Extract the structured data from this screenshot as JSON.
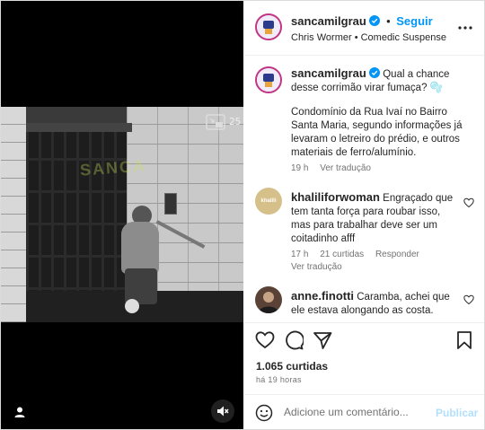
{
  "colors": {
    "accent": "#0095f6",
    "text": "#262626",
    "muted": "#737373",
    "border": "#dbdbdb",
    "media_bg": "#000000"
  },
  "media": {
    "watermark": "SANCA",
    "camera_timestamp": "25",
    "icons": [
      "picture-in-picture-icon",
      "user-tag-icon",
      "mute-icon"
    ]
  },
  "header": {
    "username": "sancamilgrau",
    "separator": "•",
    "follow_label": "Seguir",
    "subtitle": "Chris Wormer • Comedic Suspense"
  },
  "caption": {
    "username": "sancamilgrau",
    "text_line1": "Qual a chance desse corrimão virar fumaça? 🫧",
    "text_body": "Condomínio da Rua Ivaí no Bairro Santa Maria, segundo informações já levaram o letreiro do prédio, e outros materiais de ferro/alumínio.",
    "time": "19 h",
    "translation": "Ver tradução"
  },
  "comments": [
    {
      "username": "khaliliforwoman",
      "text": "Engraçado que tem tanta força para roubar isso, mas para trabalhar deve ser um coitadinho afff",
      "time": "17 h",
      "likes": "21 curtidas",
      "reply": "Responder",
      "translation": "Ver tradução",
      "avatar_text": "khalili"
    },
    {
      "username": "anne.finotti",
      "text": "Caramba, achei que ele estava alongando as costa."
    }
  ],
  "stats": {
    "likes": "1.065 curtidas",
    "time_ago": "há 19 horas"
  },
  "comment_box": {
    "placeholder": "Adicione um comentário...",
    "post_label": "Publicar"
  }
}
